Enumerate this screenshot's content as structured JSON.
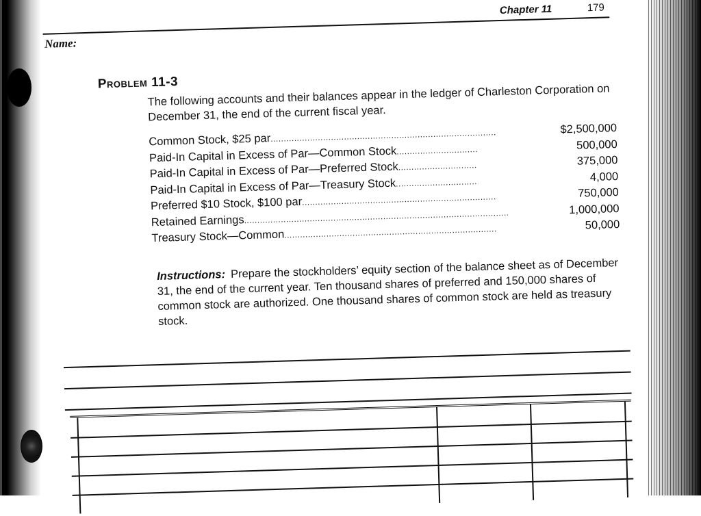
{
  "header": {
    "name_label": "Name:",
    "chapter": "Chapter 11",
    "page_number": "179"
  },
  "problem": {
    "title_word": "Problem",
    "title_number": "11-3",
    "intro": "The following accounts and their balances appear in the ledger of Charleston Corporation on December 31, the end of the current fiscal year."
  },
  "accounts": [
    {
      "name": "Common Stock, $25 par",
      "amount": "$2,500,000"
    },
    {
      "name": "Paid-In Capital in Excess of Par—Common Stock",
      "amount": "500,000"
    },
    {
      "name": "Paid-In Capital in Excess of Par—Preferred Stock",
      "amount": "375,000"
    },
    {
      "name": "Paid-In Capital in Excess of Par—Treasury Stock",
      "amount": "4,000"
    },
    {
      "name": "Preferred $10 Stock, $100 par",
      "amount": "750,000"
    },
    {
      "name": "Retained Earnings",
      "amount": "1,000,000"
    },
    {
      "name": "Treasury Stock—Common",
      "amount": "50,000"
    }
  ],
  "instructions": {
    "label": "Instructions:",
    "text": "Prepare the stockholders’ equity section of the balance sheet as of December 31, the end of the current year. Ten thousand shares of preferred and 150,000 shares of common stock are authorized. One thousand shares of common stock are held as treasury stock."
  }
}
